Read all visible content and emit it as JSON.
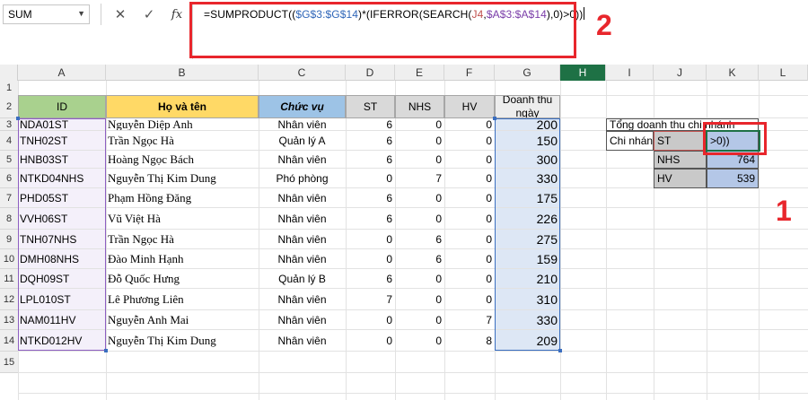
{
  "formula_bar": {
    "name_box": "SUM",
    "cancel_icon": "✕",
    "enter_icon": "✓",
    "fx_label": "fx",
    "formula_parts": [
      "=SUMPRODUCT((",
      "$G$3:$G$14",
      ")*(IFERROR(SEARCH(",
      "J4",
      ",",
      "$A$3:$A$14",
      "),0)>0))"
    ]
  },
  "annotations": {
    "label_1": "1",
    "label_2": "2"
  },
  "columns": [
    "A",
    "B",
    "C",
    "D",
    "E",
    "F",
    "G",
    "H",
    "I",
    "J",
    "K",
    "L"
  ],
  "rows": [
    "1",
    "2",
    "3",
    "4",
    "5",
    "6",
    "7",
    "8",
    "9",
    "10",
    "11",
    "12",
    "13",
    "14",
    "15"
  ],
  "table": {
    "headers": [
      "ID",
      "Họ và tên",
      "Chức vụ",
      "ST",
      "NHS",
      "HV",
      "Doanh thu ngày"
    ],
    "rows": [
      [
        "NDA01ST",
        "Nguyễn Diệp Anh",
        "Nhân viên",
        "6",
        "0",
        "0",
        "200"
      ],
      [
        "TNH02ST",
        "Trần Ngọc Hà",
        "Quản lý A",
        "6",
        "0",
        "0",
        "150"
      ],
      [
        "HNB03ST",
        "Hoàng Ngọc Bách",
        "Nhân viên",
        "6",
        "0",
        "0",
        "300"
      ],
      [
        "NTKD04NHS",
        "Nguyễn Thị Kim Dung",
        "Phó phòng",
        "0",
        "7",
        "0",
        "330"
      ],
      [
        "PHD05ST",
        "Phạm Hồng Đăng",
        "Nhân viên",
        "6",
        "0",
        "0",
        "175"
      ],
      [
        "VVH06ST",
        "Vũ Việt Hà",
        "Nhân viên",
        "6",
        "0",
        "0",
        "226"
      ],
      [
        "TNH07NHS",
        "Trần Ngọc Hà",
        "Nhân viên",
        "0",
        "6",
        "0",
        "275"
      ],
      [
        "DMH08NHS",
        "Đào Minh Hạnh",
        "Nhân viên",
        "0",
        "6",
        "0",
        "159"
      ],
      [
        "DQH09ST",
        "Đỗ Quốc Hưng",
        "Quản lý B",
        "6",
        "0",
        "0",
        "210"
      ],
      [
        "LPL010ST",
        "Lê Phương Liên",
        "Nhân viên",
        "7",
        "0",
        "0",
        "310"
      ],
      [
        "NAM011HV",
        "Nguyễn Anh Mai",
        "Nhân viên",
        "0",
        "0",
        "7",
        "330"
      ],
      [
        "NTKD012HV",
        "Nguyễn Thị Kim Dung",
        "Nhân viên",
        "0",
        "0",
        "8",
        "209"
      ]
    ]
  },
  "summary": {
    "title": "Tổng doanh thu chi nhánh",
    "branch_label": "Chi nhánh",
    "rows": [
      {
        "branch": "ST",
        "value": ">0))"
      },
      {
        "branch": "NHS",
        "value": "764"
      },
      {
        "branch": "HV",
        "value": "539"
      }
    ]
  },
  "colors": {
    "id_header": "#a9d18e",
    "name_header": "#ffd966",
    "role_header": "#9dc3e6",
    "count_header": "#d9d9d9",
    "revenue_header": "#ededed",
    "summary_label": "#c9c9c9",
    "summary_value": "#b4c7e7",
    "highlight_red": "#e8262c"
  }
}
